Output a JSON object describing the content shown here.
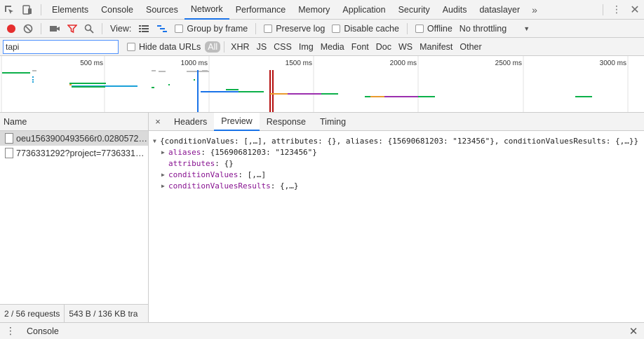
{
  "tabbar": {
    "tabs": [
      "Elements",
      "Console",
      "Sources",
      "Network",
      "Performance",
      "Memory",
      "Application",
      "Security",
      "Audits",
      "dataslayer"
    ],
    "active_index": 3,
    "more": "»"
  },
  "toolbar": {
    "view_label": "View:",
    "group_by_frame": "Group by frame",
    "preserve_log": "Preserve log",
    "disable_cache": "Disable cache",
    "offline": "Offline",
    "throttling": "No throttling"
  },
  "filterbar": {
    "filter_value": "tapi",
    "hide_data_urls": "Hide data URLs",
    "types": [
      "All",
      "XHR",
      "JS",
      "CSS",
      "Img",
      "Media",
      "Font",
      "Doc",
      "WS",
      "Manifest",
      "Other"
    ],
    "selected_type": "All"
  },
  "overview": {
    "ticks": [
      "500 ms",
      "1000 ms",
      "1500 ms",
      "2000 ms",
      "2500 ms",
      "3000 ms"
    ]
  },
  "requests": {
    "header": "Name",
    "items": [
      {
        "name": "oeu1563900493566r0.0280572…"
      },
      {
        "name": "7736331292?project=7736331…"
      }
    ],
    "count": "2 / 56 requests",
    "size": "543 B / 136 KB tra"
  },
  "detail": {
    "close": "×",
    "tabs": [
      "Headers",
      "Preview",
      "Response",
      "Timing"
    ],
    "active_index": 1,
    "preview": {
      "root": "{conditionValues: [,…], attributes: {}, aliases: {15690681203: \"123456\"}, conditionValuesResults: {,…}}",
      "lines": [
        {
          "key": "aliases",
          "value": "{15690681203: \"123456\"}",
          "expandable": true
        },
        {
          "key": "attributes",
          "value": "{}",
          "expandable": false
        },
        {
          "key": "conditionValues",
          "value": "[,…]",
          "expandable": true
        },
        {
          "key": "conditionValuesResults",
          "value": "{,…}",
          "expandable": true
        }
      ]
    }
  },
  "drawer": {
    "tab": "Console"
  },
  "colors": {
    "record": "#e52e2e",
    "filter_icon": "#e52e2e",
    "accent": "#1a73e8",
    "key": "#881391"
  }
}
